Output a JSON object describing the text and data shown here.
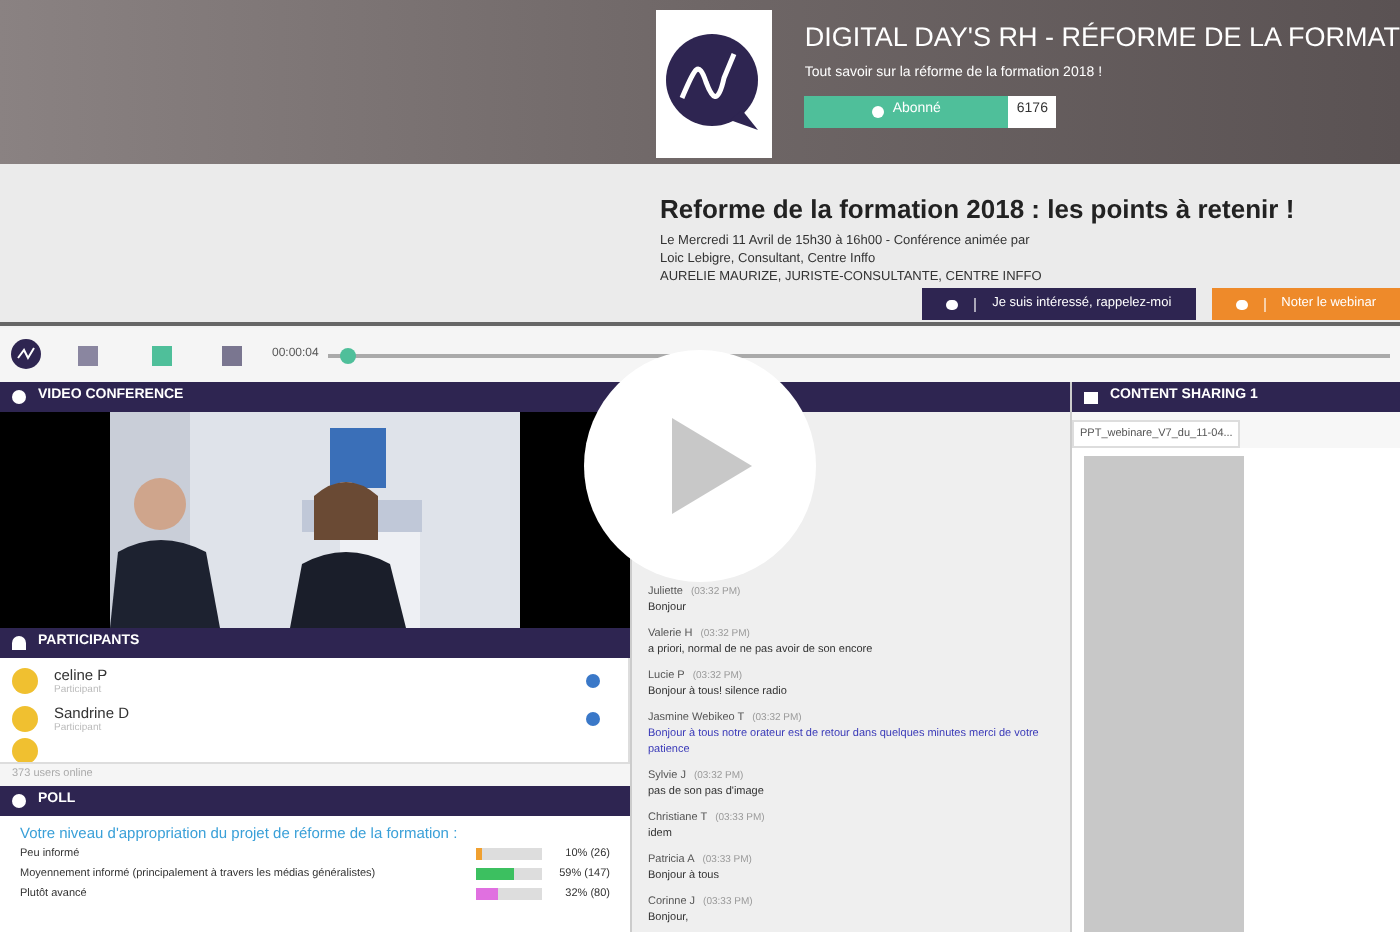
{
  "banner": {
    "title": "DIGITAL DAY'S RH - RÉFORME DE LA FORMAT",
    "subtitle": "Tout savoir sur la réforme de la formation 2018 !",
    "subscribe_label": "Abonné",
    "subscribers": "6176"
  },
  "event": {
    "title": "Reforme de la formation 2018 : les points à retenir !",
    "lines": [
      "Le Mercredi 11 Avril de 15h30 à 16h00 - Conférence animée par",
      "Loic Lebigre, Consultant, Centre Inffo",
      "AURELIE MAURIZE, JURISTE-CONSULTANTE, CENTRE INFFO"
    ],
    "buttons": [
      {
        "label": "Je suis intéressé, rappelez-moi",
        "kind": "callback"
      },
      {
        "label": "Noter le webinar",
        "kind": "rate"
      }
    ]
  },
  "player": {
    "time": "00:00:04",
    "level": 0.01
  },
  "video": {
    "title": "VIDEO CONFERENCE"
  },
  "participants": {
    "title": "PARTICIPANTS",
    "items": [
      {
        "name": "celine P",
        "role": "Participant"
      },
      {
        "name": "Sandrine D",
        "role": "Participant"
      }
    ],
    "footer": "373 users online"
  },
  "poll": {
    "title": "POLL",
    "question": "Votre niveau d'appropriation du projet de réforme de la formation :",
    "options": [
      {
        "label": "Peu informé",
        "level": 0.1,
        "result": "10% (26)",
        "color": "#f0a030"
      },
      {
        "label": "Moyennement informé (principalement à travers les médias généralistes)",
        "level": 0.59,
        "result": "59% (147)",
        "color": "#3cc060"
      },
      {
        "label": "Plutôt avancé",
        "level": 0.32,
        "result": "32% (80)",
        "color": "#e070e0"
      }
    ]
  },
  "chat": {
    "messages": [
      {
        "name": "Juliette",
        "time": "(03:32 PM)",
        "text": "Bonjour",
        "kind": "user"
      },
      {
        "name": "Valerie H",
        "time": "(03:32 PM)",
        "text": "a priori, normal de ne pas avoir de son encore",
        "kind": "user"
      },
      {
        "name": "Lucie P",
        "time": "(03:32 PM)",
        "text": "Bonjour à tous! silence radio",
        "kind": "user"
      },
      {
        "name": "Jasmine Webikeo T",
        "time": "(03:32 PM)",
        "text": "Bonjour à tous notre orateur est de retour dans quelques minutes merci de votre patience",
        "kind": "moderator"
      },
      {
        "name": "Sylvie J",
        "time": "(03:32 PM)",
        "text": "pas de son pas d'image",
        "kind": "user"
      },
      {
        "name": "Christiane T",
        "time": "(03:33 PM)",
        "text": "idem",
        "kind": "user"
      },
      {
        "name": "Patricia A",
        "time": "(03:33 PM)",
        "text": "Bonjour à tous",
        "kind": "user"
      },
      {
        "name": "Corinne J",
        "time": "(03:33 PM)",
        "text": "Bonjour,",
        "kind": "user"
      }
    ]
  },
  "sharing": {
    "title": "CONTENT SHARING 1",
    "file": "PPT_webinare_V7_du_11-04..."
  }
}
